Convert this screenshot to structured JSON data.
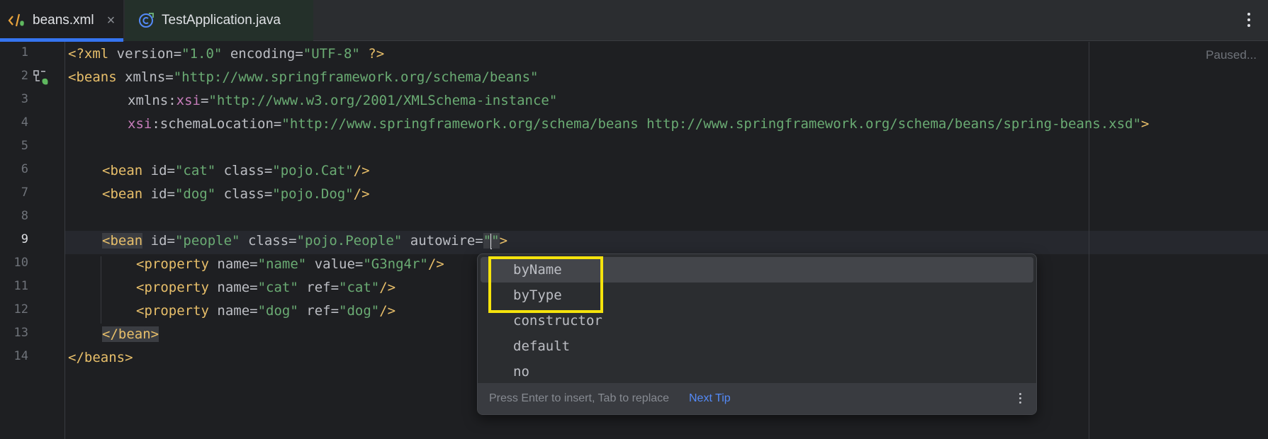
{
  "tabs": [
    {
      "label": "beans.xml",
      "icon": "xml-file-icon",
      "active": true,
      "close": "×"
    },
    {
      "label": "TestApplication.java",
      "icon": "java-class-icon",
      "active": false
    }
  ],
  "editor": {
    "status": "Paused...",
    "line_numbers": [
      "1",
      "2",
      "3",
      "4",
      "5",
      "6",
      "7",
      "8",
      "9",
      "10",
      "11",
      "12",
      "13",
      "14"
    ],
    "active_line": "9"
  },
  "code": {
    "l1": {
      "p1": "<?xml ",
      "p2": "version",
      "p3": "=",
      "p4": "\"1.0\"",
      "p5": " encoding",
      "p6": "=",
      "p7": "\"UTF-8\"",
      "p8": " ?>"
    },
    "l2": {
      "p1": "<beans ",
      "p2": "xmlns",
      "p3": "=",
      "p4": "\"http://www.springframework.org/schema/beans\""
    },
    "l3": {
      "p1": "xmlns:",
      "p2": "xsi",
      "p3": "=",
      "p4": "\"http://www.w3.org/2001/XMLSchema-instance\""
    },
    "l4": {
      "p1": "xsi",
      "p2": ":schemaLocation",
      "p3": "=",
      "p4": "\"http://www.springframework.org/schema/beans http://www.springframework.org/schema/beans/spring-beans.xsd\"",
      "p5": ">"
    },
    "l6": {
      "p1": "<bean ",
      "p2": "id",
      "p3": "=",
      "p4": "\"cat\"",
      "p5": " class",
      "p6": "=",
      "p7": "\"pojo.Cat\"",
      "p8": "/>"
    },
    "l7": {
      "p1": "<bean ",
      "p2": "id",
      "p3": "=",
      "p4": "\"dog\"",
      "p5": " class",
      "p6": "=",
      "p7": "\"pojo.Dog\"",
      "p8": "/>"
    },
    "l9": {
      "p1": "<bean",
      "p2": " id",
      "p3": "=",
      "p4": "\"people\"",
      "p5": " class",
      "p6": "=",
      "p7": "\"pojo.People\"",
      "p8": " autowire",
      "p9": "=",
      "p10": "\"",
      "p11": "\"",
      "p12": ">"
    },
    "l10": {
      "p1": "<property ",
      "p2": "name",
      "p3": "=",
      "p4": "\"name\"",
      "p5": " value",
      "p6": "=",
      "p7": "\"G3ng4r\"",
      "p8": "/>"
    },
    "l11": {
      "p1": "<property ",
      "p2": "name",
      "p3": "=",
      "p4": "\"cat\"",
      "p5": " ref",
      "p6": "=",
      "p7": "\"cat\"",
      "p8": "/>"
    },
    "l12": {
      "p1": "<property ",
      "p2": "name",
      "p3": "=",
      "p4": "\"dog\"",
      "p5": " ref",
      "p6": "=",
      "p7": "\"dog\"",
      "p8": "/>"
    },
    "l13": {
      "p1": "</bean>"
    },
    "l14": {
      "p1": "</beans>"
    }
  },
  "completion": {
    "items": [
      "byName",
      "byType",
      "constructor",
      "default",
      "no"
    ],
    "selected": "byName",
    "hint": "Press Enter to insert, Tab to replace",
    "next_tip": "Next Tip"
  },
  "colors": {
    "tag": "#e8bf6a",
    "string": "#6aab73",
    "namespace": "#c77dbb",
    "accent": "#3574f0",
    "highlight_box": "#f5e30c"
  }
}
